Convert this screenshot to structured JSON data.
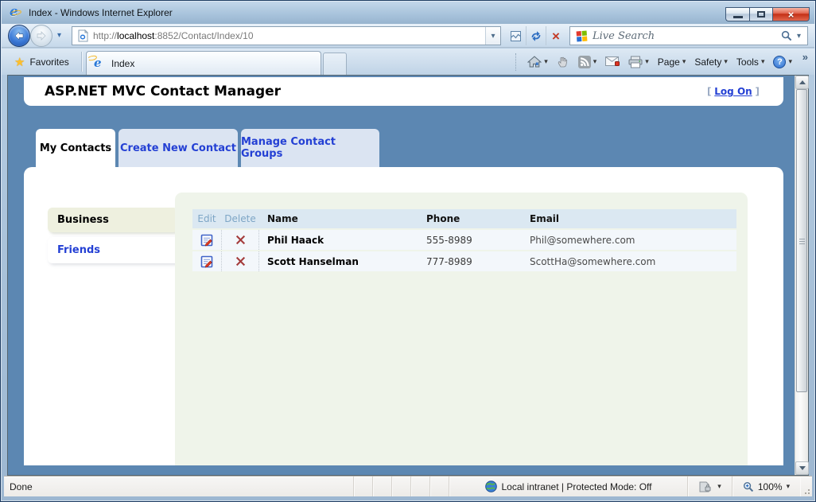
{
  "colors": {
    "page_background": "#5c87b2",
    "link_blue": "#2440d4",
    "tab_inactive_bg": "#dbe4f2",
    "green_panel_bg": "#eff4ea",
    "table_header_bg": "#dbe8f2",
    "table_row_bg": "#f3f7fb",
    "close_button_red": "#c22d12",
    "favorites_star_gold": "#fcbf2e"
  },
  "icons": {
    "caret": "▾",
    "overflow_chevron": "»",
    "help_glyph": "?",
    "close_glyph": "×",
    "star_glyph": "★",
    "stop_glyph": "×"
  },
  "titlebar": {
    "title": "Index - Windows Internet Explorer"
  },
  "address_bar": {
    "scheme": "http://",
    "domain": "localhost",
    "path": ":8852/Contact/Index/10"
  },
  "search_box": {
    "placeholder": "Live Search"
  },
  "favorites_bar": {
    "button_label": "Favorites",
    "tab_title": "Index"
  },
  "command_bar": {
    "page_label": "Page",
    "safety_label": "Safety",
    "tools_label": "Tools"
  },
  "page": {
    "header": {
      "title": "ASP.NET MVC Contact Manager",
      "login_open_bracket": "[",
      "login_link": "Log On",
      "login_close_bracket": "]"
    },
    "tabs": [
      {
        "label": "My Contacts",
        "active": true
      },
      {
        "label": "Create New Contact",
        "active": false
      },
      {
        "label": "Manage Contact Groups",
        "active": false
      }
    ],
    "groups": [
      {
        "label": "Business",
        "selected": true
      },
      {
        "label": "Friends",
        "selected": false
      }
    ],
    "contacts_table": {
      "headers": {
        "edit": "Edit",
        "delete": "Delete",
        "name": "Name",
        "phone": "Phone",
        "email": "Email"
      },
      "rows": [
        {
          "name": "Phil Haack",
          "phone": "555-8989",
          "email": "Phil@somewhere.com"
        },
        {
          "name": "Scott Hanselman",
          "phone": "777-8989",
          "email": "ScottHa@somewhere.com"
        }
      ]
    }
  },
  "status_bar": {
    "status": "Done",
    "zone_text": "Local intranet | Protected Mode: Off",
    "zoom_level": "100%"
  }
}
